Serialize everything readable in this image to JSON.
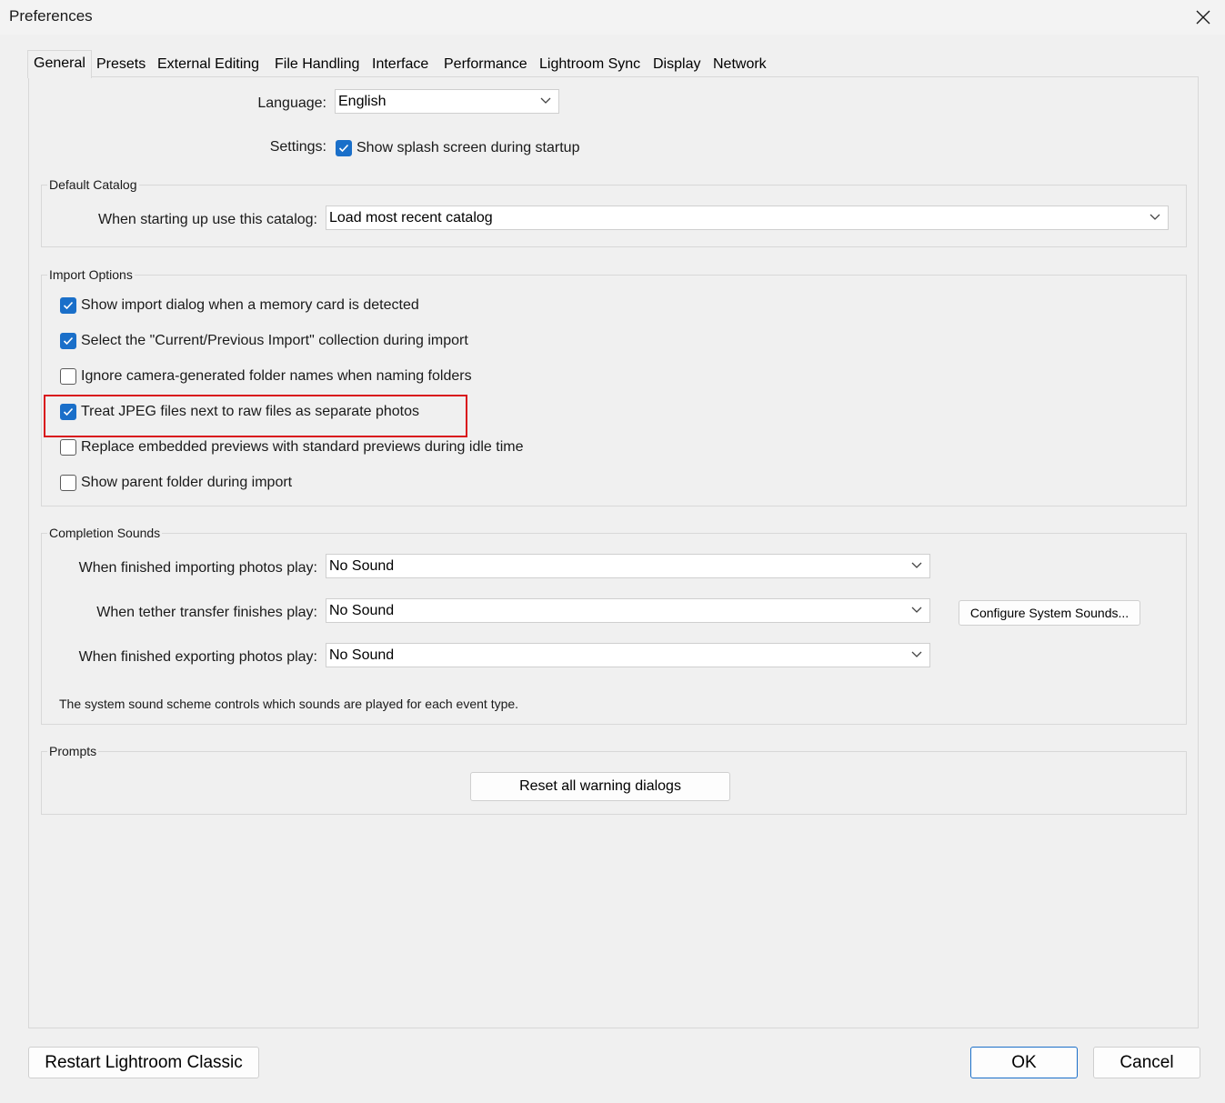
{
  "window": {
    "title": "Preferences"
  },
  "tabs": [
    {
      "label": "General",
      "active": true
    },
    {
      "label": "Presets"
    },
    {
      "label": "External Editing"
    },
    {
      "label": "File Handling"
    },
    {
      "label": "Interface"
    },
    {
      "label": "Performance"
    },
    {
      "label": "Lightroom Sync"
    },
    {
      "label": "Display"
    },
    {
      "label": "Network"
    }
  ],
  "general": {
    "language_label": "Language:",
    "language_value": "English",
    "settings_label": "Settings:",
    "splash_label": "Show splash screen during startup",
    "splash_checked": true
  },
  "default_catalog": {
    "title": "Default Catalog",
    "label": "When starting up use this catalog:",
    "value": "Load most recent catalog"
  },
  "import_options": {
    "title": "Import Options",
    "items": [
      {
        "label": "Show import dialog when a memory card is detected",
        "checked": true
      },
      {
        "label": "Select the \"Current/Previous Import\" collection during import",
        "checked": true
      },
      {
        "label": "Ignore camera-generated folder names when naming folders",
        "checked": false
      },
      {
        "label": "Treat JPEG files next to raw files as separate photos",
        "checked": true
      },
      {
        "label": "Replace embedded previews with standard previews during idle time",
        "checked": false
      },
      {
        "label": "Show parent folder during import",
        "checked": false
      }
    ]
  },
  "completion_sounds": {
    "title": "Completion Sounds",
    "rows": [
      {
        "label": "When finished importing photos play:",
        "value": "No Sound"
      },
      {
        "label": "When tether transfer finishes play:",
        "value": "No Sound"
      },
      {
        "label": "When finished exporting photos play:",
        "value": "No Sound"
      }
    ],
    "configure_button": "Configure System Sounds...",
    "note": "The system sound scheme controls which sounds are played for each event type."
  },
  "prompts": {
    "title": "Prompts",
    "reset_button": "Reset all warning dialogs"
  },
  "footer": {
    "restart_button": "Restart Lightroom Classic",
    "ok_button": "OK",
    "cancel_button": "Cancel"
  },
  "colors": {
    "accent": "#1a6fc9",
    "highlight": "#d9151c",
    "background": "#f0f0f0"
  }
}
